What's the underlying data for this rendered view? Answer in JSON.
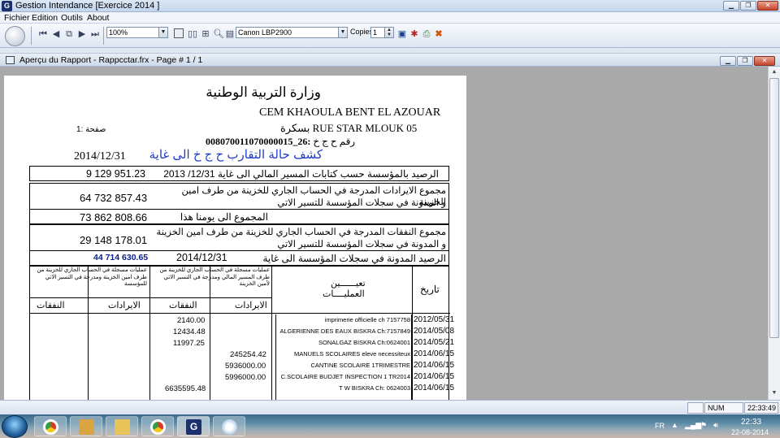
{
  "window": {
    "title": "Gestion Intendance [Exercice  2014 ]",
    "app_icon": "G"
  },
  "menu": [
    "Fichier",
    "Edition",
    "Outils",
    "About"
  ],
  "toolbar": {
    "zoom": "100%",
    "printer": "Canon LBP2900",
    "copies_label": "Copies",
    "copies_value": "1"
  },
  "child": {
    "title": "Aperçu du Rapport - Rappcctar.frx - Page # 1 / 1"
  },
  "report": {
    "ministry": "وزارة التربية الوطنية",
    "school": "CEM KHAOULA BENT  EL AZOUAR",
    "address_city": "بسكرة",
    "address": "RUE STAR MLOUK 05",
    "account_label": "رقم ح ج خ",
    "account_number": "008070011070000015_26:",
    "page_label": "صفحة :1",
    "date": "2014/12/31",
    "heading": "كشف حالة التقارب ح ج خ الى غاية",
    "rows": [
      {
        "label": "الرصيد بالمؤسسة حسب كتابات المسير المالي الى غاية 12/31/ 2013",
        "value": "9 129 951.23"
      },
      {
        "label": "مجموع الايرادات المدرجة في الحساب الجاري للخزينة من طرف امين الخزينة",
        "label2": "و المدونة  في سجلات المؤسسة للتسير الاتي",
        "value": "64 732 857.43"
      },
      {
        "label": "المجموع الى يومنا هذا",
        "value": "73 862 808.66"
      },
      {
        "label": "مجموع النفقات  المدرجة في الحساب الجاري للخزينة من طرف امين الخزينة",
        "label2": "و المدونة  في سجلات المؤسسة للتسير الاتي",
        "value": "29 148 178.01"
      },
      {
        "label": "الرصيد المدونة في سجلات المؤسسة الى غاية",
        "date": "2014/12/31",
        "value": "44 714 630.65"
      }
    ],
    "table": {
      "col_date": "تاريخ",
      "col_desc": "تعيــــــين",
      "col_desc2": "العمليــــات",
      "group1": "عمليات مسجلة في الحساب الجاري للخزينة من طرف المسير المالي ومدرجة في التسير الاتي لأمين الخزينة",
      "group2": "عمليات مسجلة في الحساب الجاري للخزينة من طرف امين الخزينة  ومدرجة في التسير الاتي للمؤسسة",
      "h_rev": "الايرادات",
      "h_exp": "النفقات",
      "rows": [
        {
          "date": "2012/05/31",
          "desc": "imprimerie officielle ch 7157758",
          "exp": "2140.00",
          "rev": ""
        },
        {
          "date": "2014/05/08",
          "desc": "ALGERIENNE DES EAUX BISKRA  Ch:7157849",
          "exp": "12434.48",
          "rev": ""
        },
        {
          "date": "2014/05/21",
          "desc": "SONALGAZ BISKRA  Ch:0624001",
          "exp": "11997.25",
          "rev": ""
        },
        {
          "date": "2014/06/15",
          "desc": "MANUELS SCOLAIRES eleve necessiteux",
          "exp": "",
          "rev": "245254.42"
        },
        {
          "date": "2014/06/15",
          "desc": "CANTINE  SCOLAIRE 1TRIMESTRE",
          "exp": "",
          "rev": "5936000.00"
        },
        {
          "date": "2014/06/15",
          "desc": "C.SCOLAIRE BUDJET INSPECTION  1 TR2014",
          "exp": "",
          "rev": "5996000.00"
        },
        {
          "date": "2014/06/15",
          "desc": "T W BISKRA              Ch: 0624003",
          "exp": "6635595.48",
          "rev": ""
        }
      ]
    }
  },
  "status": {
    "num": "NUM",
    "time": "22:33:49"
  },
  "taskbar": {
    "lang": "FR",
    "time": "22:33",
    "date": "22-08-2014"
  },
  "colors": {
    "heading_blue": "#1e3cc8",
    "value_blue": "#0b1f8a"
  }
}
